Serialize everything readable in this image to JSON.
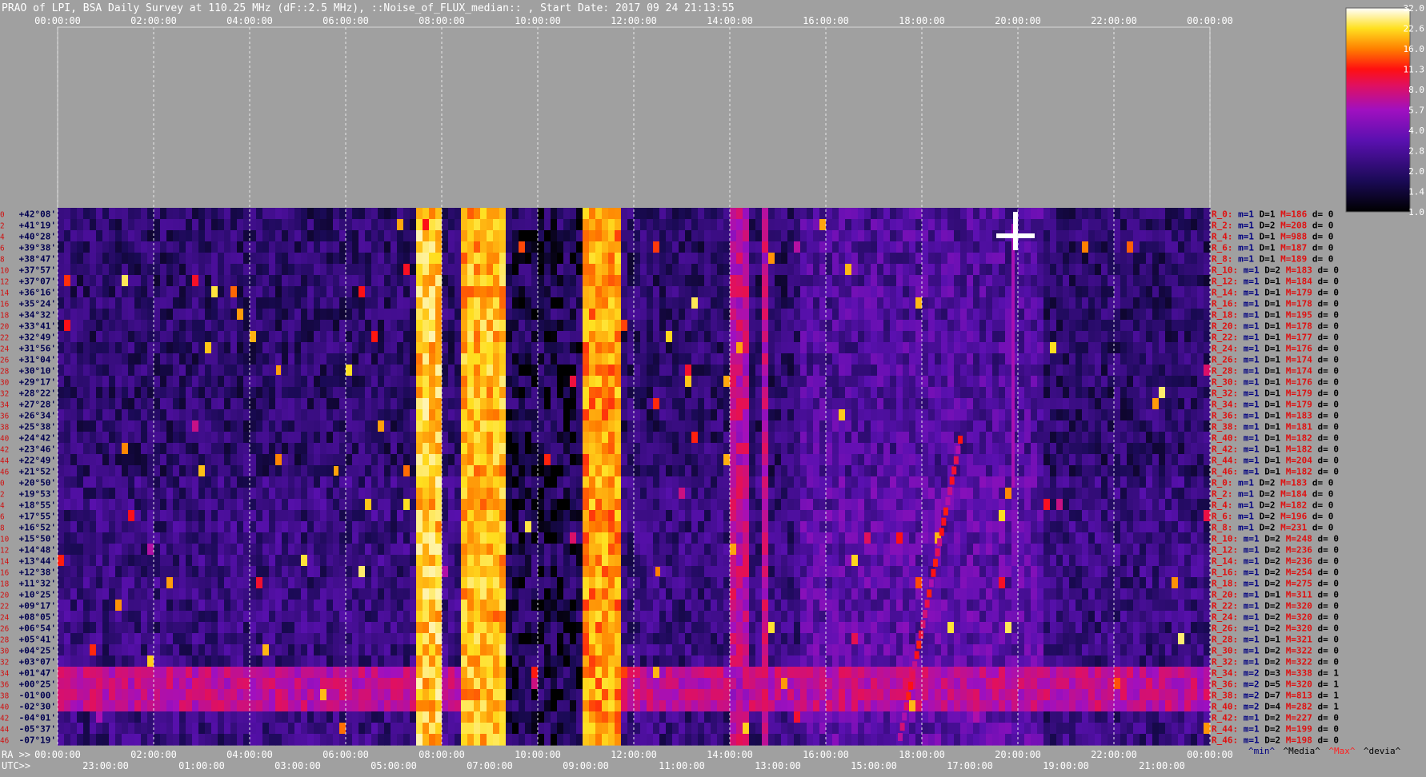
{
  "chart_data": {
    "type": "heatmap",
    "title": "PRAO of LPI, BSA Daily Survey at 110.25 MHz (dF::2.5 MHz), ::Noise_of_FLUX_median:: , Start Date: 2017 09 24 21:13:55",
    "x_top_ticks": [
      "00:00:00",
      "02:00:00",
      "04:00:00",
      "06:00:00",
      "08:00:00",
      "10:00:00",
      "12:00:00",
      "14:00:00",
      "16:00:00",
      "18:00:00",
      "20:00:00",
      "22:00:00",
      "00:00:00"
    ],
    "ra_prefix": "RA >>",
    "ra_ticks": [
      "00:00:00",
      "02:00:00",
      "04:00:00",
      "06:00:00",
      "08:00:00",
      "10:00:00",
      "12:00:00",
      "14:00:00",
      "16:00:00",
      "18:00:00",
      "20:00:00",
      "22:00:00",
      "00:00:00"
    ],
    "utc_prefix": "UTC>>",
    "utc_ticks": [
      "23:00:00",
      "01:00:00",
      "03:00:00",
      "05:00:00",
      "07:00:00",
      "09:00:00",
      "11:00:00",
      "13:00:00",
      "15:00:00",
      "17:00:00",
      "19:00:00",
      "21:00:00"
    ],
    "row_index_labels": [
      "0",
      "2",
      "4",
      "6",
      "8",
      "10",
      "12",
      "14",
      "16",
      "18",
      "20",
      "22",
      "24",
      "26",
      "28",
      "30",
      "32",
      "34",
      "36",
      "38",
      "40",
      "42",
      "44",
      "46",
      "0",
      "2",
      "4",
      "6",
      "8",
      "10",
      "12",
      "14",
      "16",
      "18",
      "20",
      "22",
      "24",
      "26",
      "28",
      "30",
      "32",
      "34",
      "36",
      "38",
      "40",
      "42",
      "44",
      "46"
    ],
    "declinations": [
      "+42°08'",
      "+41°19'",
      "+40°28'",
      "+39°38'",
      "+38°47'",
      "+37°57'",
      "+37°07'",
      "+36°16'",
      "+35°24'",
      "+34°32'",
      "+33°41'",
      "+32°49'",
      "+31°56'",
      "+31°04'",
      "+30°10'",
      "+29°17'",
      "+28°22'",
      "+27°28'",
      "+26°34'",
      "+25°38'",
      "+24°42'",
      "+23°46'",
      "+22°49'",
      "+21°52'",
      "+20°50'",
      "+19°53'",
      "+18°55'",
      "+17°55'",
      "+16°52'",
      "+15°50'",
      "+14°48'",
      "+13°44'",
      "+12°38'",
      "+11°32'",
      "+10°25'",
      "+09°17'",
      "+08°05'",
      "+06°54'",
      "+05°41'",
      "+04°25'",
      "+03°07'",
      "+01°47'",
      "+00°25'",
      "-01°00'",
      "-02°30'",
      "-04°01'",
      "-05°37'",
      "-07°19'"
    ],
    "beam_stats": [
      {
        "r": "R_0:",
        "m": "m=1",
        "d": "D=1",
        "mx": "M=186",
        "dv": "d= 0"
      },
      {
        "r": "R_2:",
        "m": "m=1",
        "d": "D=2",
        "mx": "M=208",
        "dv": "d= 0"
      },
      {
        "r": "R_4:",
        "m": "m=1",
        "d": "D=1",
        "mx": "M=988",
        "dv": "d= 0"
      },
      {
        "r": "R_6:",
        "m": "m=1",
        "d": "D=1",
        "mx": "M=187",
        "dv": "d= 0"
      },
      {
        "r": "R_8:",
        "m": "m=1",
        "d": "D=1",
        "mx": "M=189",
        "dv": "d= 0"
      },
      {
        "r": "R_10:",
        "m": "m=1",
        "d": "D=2",
        "mx": "M=183",
        "dv": "d= 0"
      },
      {
        "r": "R_12:",
        "m": "m=1",
        "d": "D=1",
        "mx": "M=184",
        "dv": "d= 0"
      },
      {
        "r": "R_14:",
        "m": "m=1",
        "d": "D=1",
        "mx": "M=179",
        "dv": "d= 0"
      },
      {
        "r": "R_16:",
        "m": "m=1",
        "d": "D=1",
        "mx": "M=178",
        "dv": "d= 0"
      },
      {
        "r": "R_18:",
        "m": "m=1",
        "d": "D=1",
        "mx": "M=195",
        "dv": "d= 0"
      },
      {
        "r": "R_20:",
        "m": "m=1",
        "d": "D=1",
        "mx": "M=178",
        "dv": "d= 0"
      },
      {
        "r": "R_22:",
        "m": "m=1",
        "d": "D=1",
        "mx": "M=177",
        "dv": "d= 0"
      },
      {
        "r": "R_24:",
        "m": "m=1",
        "d": "D=1",
        "mx": "M=176",
        "dv": "d= 0"
      },
      {
        "r": "R_26:",
        "m": "m=1",
        "d": "D=1",
        "mx": "M=174",
        "dv": "d= 0"
      },
      {
        "r": "R_28:",
        "m": "m=1",
        "d": "D=1",
        "mx": "M=174",
        "dv": "d= 0"
      },
      {
        "r": "R_30:",
        "m": "m=1",
        "d": "D=1",
        "mx": "M=176",
        "dv": "d= 0"
      },
      {
        "r": "R_32:",
        "m": "m=1",
        "d": "D=1",
        "mx": "M=179",
        "dv": "d= 0"
      },
      {
        "r": "R_34:",
        "m": "m=1",
        "d": "D=1",
        "mx": "M=179",
        "dv": "d= 0"
      },
      {
        "r": "R_36:",
        "m": "m=1",
        "d": "D=1",
        "mx": "M=183",
        "dv": "d= 0"
      },
      {
        "r": "R_38:",
        "m": "m=1",
        "d": "D=1",
        "mx": "M=181",
        "dv": "d= 0"
      },
      {
        "r": "R_40:",
        "m": "m=1",
        "d": "D=1",
        "mx": "M=182",
        "dv": "d= 0"
      },
      {
        "r": "R_42:",
        "m": "m=1",
        "d": "D=1",
        "mx": "M=182",
        "dv": "d= 0"
      },
      {
        "r": "R_44:",
        "m": "m=1",
        "d": "D=1",
        "mx": "M=204",
        "dv": "d= 0"
      },
      {
        "r": "R_46:",
        "m": "m=1",
        "d": "D=1",
        "mx": "M=182",
        "dv": "d= 0"
      },
      {
        "r": "R_0:",
        "m": "m=1",
        "d": "D=2",
        "mx": "M=183",
        "dv": "d= 0"
      },
      {
        "r": "R_2:",
        "m": "m=1",
        "d": "D=2",
        "mx": "M=184",
        "dv": "d= 0"
      },
      {
        "r": "R_4:",
        "m": "m=1",
        "d": "D=2",
        "mx": "M=182",
        "dv": "d= 0"
      },
      {
        "r": "R_6:",
        "m": "m=1",
        "d": "D=2",
        "mx": "M=196",
        "dv": "d= 0"
      },
      {
        "r": "R_8:",
        "m": "m=1",
        "d": "D=2",
        "mx": "M=231",
        "dv": "d= 0"
      },
      {
        "r": "R_10:",
        "m": "m=1",
        "d": "D=2",
        "mx": "M=248",
        "dv": "d= 0"
      },
      {
        "r": "R_12:",
        "m": "m=1",
        "d": "D=2",
        "mx": "M=236",
        "dv": "d= 0"
      },
      {
        "r": "R_14:",
        "m": "m=1",
        "d": "D=2",
        "mx": "M=236",
        "dv": "d= 0"
      },
      {
        "r": "R_16:",
        "m": "m=1",
        "d": "D=2",
        "mx": "M=254",
        "dv": "d= 0"
      },
      {
        "r": "R_18:",
        "m": "m=1",
        "d": "D=2",
        "mx": "M=275",
        "dv": "d= 0"
      },
      {
        "r": "R_20:",
        "m": "m=1",
        "d": "D=1",
        "mx": "M=311",
        "dv": "d= 0"
      },
      {
        "r": "R_22:",
        "m": "m=1",
        "d": "D=2",
        "mx": "M=320",
        "dv": "d= 0"
      },
      {
        "r": "R_24:",
        "m": "m=1",
        "d": "D=2",
        "mx": "M=320",
        "dv": "d= 0"
      },
      {
        "r": "R_26:",
        "m": "m=1",
        "d": "D=2",
        "mx": "M=320",
        "dv": "d= 0"
      },
      {
        "r": "R_28:",
        "m": "m=1",
        "d": "D=1",
        "mx": "M=321",
        "dv": "d= 0"
      },
      {
        "r": "R_30:",
        "m": "m=1",
        "d": "D=2",
        "mx": "M=322",
        "dv": "d= 0"
      },
      {
        "r": "R_32:",
        "m": "m=1",
        "d": "D=2",
        "mx": "M=322",
        "dv": "d= 0"
      },
      {
        "r": "R_34:",
        "m": "m=2",
        "d": "D=3",
        "mx": "M=338",
        "dv": "d= 1"
      },
      {
        "r": "R_36:",
        "m": "m=2",
        "d": "D=5",
        "mx": "M=320",
        "dv": "d= 1"
      },
      {
        "r": "R_38:",
        "m": "m=2",
        "d": "D=7",
        "mx": "M=813",
        "dv": "d= 1"
      },
      {
        "r": "R_40:",
        "m": "m=2",
        "d": "D=4",
        "mx": "M=282",
        "dv": "d= 1"
      },
      {
        "r": "R_42:",
        "m": "m=1",
        "d": "D=2",
        "mx": "M=227",
        "dv": "d= 0"
      },
      {
        "r": "R_44:",
        "m": "m=1",
        "d": "D=2",
        "mx": "M=199",
        "dv": "d= 0"
      },
      {
        "r": "R_46:",
        "m": "m=1",
        "d": "D=2",
        "mx": "M=198",
        "dv": "d= 0"
      }
    ],
    "footer_legend": [
      {
        "text": "^min^",
        "color": "#000080"
      },
      {
        "text": "^Media^",
        "color": "#000000"
      },
      {
        "text": "^Max^",
        "color": "#ff2020"
      },
      {
        "text": "^devia^",
        "color": "#000000"
      }
    ],
    "colorbar_ticks": [
      "32.0",
      "22.6",
      "16.0",
      "11.3",
      "8.0",
      "5.7",
      "4.0",
      "2.8",
      "2.0",
      "1.4",
      "1.0"
    ],
    "colorbar_scale": "log",
    "colorbar_range": [
      1.0,
      32.0
    ],
    "colormap": "gnuplot-heat (black-blue-purple-red-yellow-white)",
    "features": [
      {
        "kind": "band",
        "utc_hours": [
          7.45,
          8.0
        ],
        "level": 22
      },
      {
        "kind": "band",
        "utc_hours": [
          8.4,
          9.35
        ],
        "level": 20
      },
      {
        "kind": "band",
        "utc_hours": [
          10.95,
          11.7
        ],
        "level": 18
      },
      {
        "kind": "band",
        "utc_hours": [
          14.05,
          14.4
        ],
        "level": 7
      },
      {
        "kind": "band",
        "utc_hours": [
          14.65,
          14.85
        ],
        "level": 7
      },
      {
        "kind": "lowband",
        "utc_hours": [
          9.4,
          10.9
        ],
        "level": 1.2
      },
      {
        "kind": "source",
        "ra_hours": 19.95,
        "dec_row": 2,
        "level": 32
      },
      {
        "kind": "source",
        "ra_hours": 5.8,
        "dec_row": 23,
        "level": 18
      },
      {
        "kind": "source",
        "ra_hours": 4.6,
        "dec_row": 14,
        "level": 18
      },
      {
        "kind": "source",
        "ra_hours": 12.5,
        "dec_row": 32,
        "level": 16
      }
    ],
    "background_level": 1.9,
    "hot_rows": {
      "rows": [
        41,
        42,
        43,
        44
      ],
      "level": 7
    }
  }
}
